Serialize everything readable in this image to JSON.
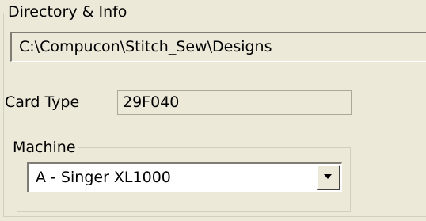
{
  "directory_group": {
    "title": "Directory & Info",
    "path": "C:\\Compucon\\Stitch_Sew\\Designs"
  },
  "card_type": {
    "label": "Card Type",
    "value": "29F040"
  },
  "machine_group": {
    "title": "Machine",
    "selected": "A - Singer XL1000",
    "dropdown_icon": "chevron-down-icon"
  }
}
